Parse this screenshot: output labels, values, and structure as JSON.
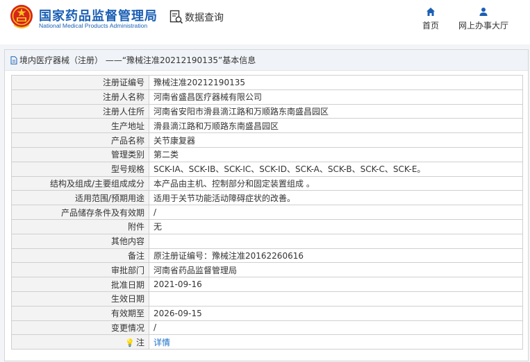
{
  "header": {
    "title_cn": "国家药品监督管理局",
    "title_en": "National Medical Products Administration",
    "query_label": "数据查询",
    "nav": [
      {
        "label": "首页",
        "icon": "home-icon"
      },
      {
        "label": "网上办事大厅",
        "icon": "user-icon"
      }
    ]
  },
  "panel": {
    "title": "境内医疗器械（注册） ——“豫械注准20212190135”基本信息"
  },
  "rows": [
    {
      "label": "注册证编号",
      "value": "豫械注准20212190135"
    },
    {
      "label": "注册人名称",
      "value": "河南省盛昌医疗器械有限公司"
    },
    {
      "label": "注册人住所",
      "value": "河南省安阳市滑县滴江路和万顺路东南盛昌园区"
    },
    {
      "label": "生产地址",
      "value": "滑县滴江路和万顺路东南盛昌园区"
    },
    {
      "label": "产品名称",
      "value": "关节康复器"
    },
    {
      "label": "管理类别",
      "value": "第二类"
    },
    {
      "label": "型号规格",
      "value": "SCK-ⅠA、SCK-ⅠB、SCK-ⅠC、SCK-ⅠD、SCK-A、SCK-B、SCK-C、SCK-E。"
    },
    {
      "label": "结构及组成/主要组成成分",
      "value": "本产品由主机、控制部分和固定装置组成 。"
    },
    {
      "label": "适用范围/预期用途",
      "value": "适用于关节功能活动障碍症状的改善。"
    },
    {
      "label": "产品储存条件及有效期",
      "value": "/"
    },
    {
      "label": "附件",
      "value": "无"
    },
    {
      "label": "其他内容",
      "value": ""
    },
    {
      "label": "备注",
      "value": "原注册证编号：豫械注准20162260616"
    },
    {
      "label": "审批部门",
      "value": "河南省药品监督管理局"
    },
    {
      "label": "批准日期",
      "value": "2021-09-16"
    },
    {
      "label": "生效日期",
      "value": ""
    },
    {
      "label": "有效期至",
      "value": "2026-09-15"
    },
    {
      "label": "变更情况",
      "value": "/"
    }
  ],
  "note_row": {
    "label": "注",
    "link": "详情"
  },
  "colors": {
    "brand_blue": "#1a5fb4",
    "logo_red": "#d8241d",
    "link_blue": "#1a6fc9"
  }
}
